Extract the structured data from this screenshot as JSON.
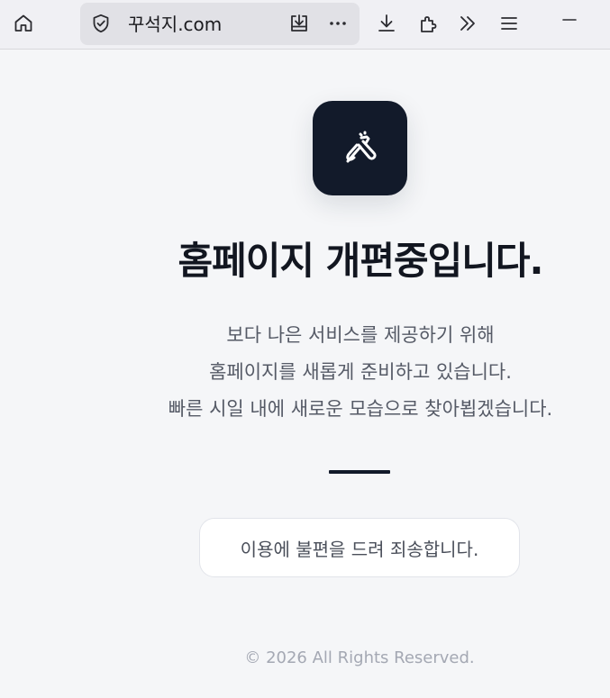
{
  "browser": {
    "url": "꾸석지.com",
    "icons": {
      "home": "home-icon",
      "shield": "shield-check-icon",
      "page_download": "save-page-icon",
      "more": "more-dots-icon",
      "downloads": "downloads-icon",
      "extensions": "extensions-icon",
      "overflow": "chevron-double-right-icon",
      "menu": "hamburger-menu-icon",
      "minimize": "minimize-icon"
    }
  },
  "page": {
    "logo_icon": "tools-icon",
    "headline": "홈페이지 개편중입니다.",
    "description": [
      "보다 나은 서비스를 제공하기 위해",
      "홈페이지를 새롭게 준비하고 있습니다.",
      "빠른 시일 내에 새로운 모습으로 찾아뵙겠습니다."
    ],
    "notice": "이용에 불편을 드려 죄송합니다.",
    "footer": "© 2026 All Rights Reserved."
  },
  "colors": {
    "background": "#f5f6f8",
    "accent_dark": "#121a2a",
    "headline": "#121620",
    "body_text": "#555a66",
    "footer_text": "#a4a8b3"
  }
}
